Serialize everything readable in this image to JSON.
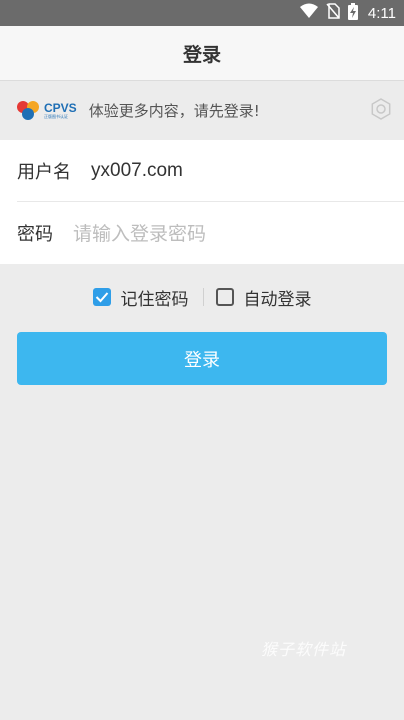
{
  "status_bar": {
    "time": "4:11",
    "icons": [
      "wifi-icon",
      "no-sim-icon",
      "battery-charging-icon"
    ]
  },
  "header": {
    "title": "登录"
  },
  "banner": {
    "logo_text": "CPVS",
    "logo_subtext": "正版图书认证",
    "message": "体验更多内容，请先登录!",
    "settings_icon": "gear-icon"
  },
  "form": {
    "username": {
      "label": "用户名",
      "value": "yx007.com"
    },
    "password": {
      "label": "密码",
      "placeholder": "请输入登录密码"
    }
  },
  "options": {
    "remember_password": {
      "label": "记住密码",
      "checked": true
    },
    "auto_login": {
      "label": "自动登录",
      "checked": false
    }
  },
  "login_button": {
    "label": "登录"
  },
  "watermark": "猴子软件站",
  "colors": {
    "accent": "#3db7ef",
    "checkbox": "#2f9ee8",
    "brand": "#1f6fb5"
  }
}
